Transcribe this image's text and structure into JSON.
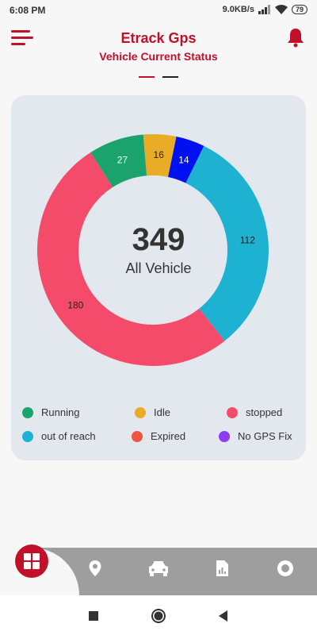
{
  "status_bar": {
    "time": "6:08 PM",
    "speed": "9.0KB/s",
    "battery": "79"
  },
  "header": {
    "title": "Etrack Gps",
    "subtitle": "Vehicle Current Status"
  },
  "summary": {
    "total": "349",
    "total_label": "All Vehicle"
  },
  "chart_data": {
    "type": "pie",
    "categories": [
      "Running",
      "Idle",
      "No GPS Fix",
      "out of reach",
      "stopped"
    ],
    "values": [
      27,
      16,
      14,
      112,
      180
    ],
    "colors": [
      "#1aa36d",
      "#e9ac26",
      "#0010f0",
      "#1eb2d2",
      "#f54b6b"
    ],
    "value_labels": [
      "27",
      "16",
      "14",
      "112",
      "180"
    ]
  },
  "legend": [
    {
      "label": "Running",
      "color": "#1aa36d"
    },
    {
      "label": "Idle",
      "color": "#e9ac26"
    },
    {
      "label": "stopped",
      "color": "#f54b6b"
    },
    {
      "label": "out of reach",
      "color": "#1eb2d2"
    },
    {
      "label": "Expired",
      "color": "#ee5640"
    },
    {
      "label": "No GPS Fix",
      "color": "#8b3cf4"
    }
  ],
  "colors": {
    "brand": "#c0102a",
    "card": "#e3e8ee",
    "nav": "#9e9e9e"
  },
  "bottom_nav": [
    "dashboard-icon",
    "location-pin-icon",
    "vehicle-icon",
    "report-icon",
    "settings-icon"
  ]
}
